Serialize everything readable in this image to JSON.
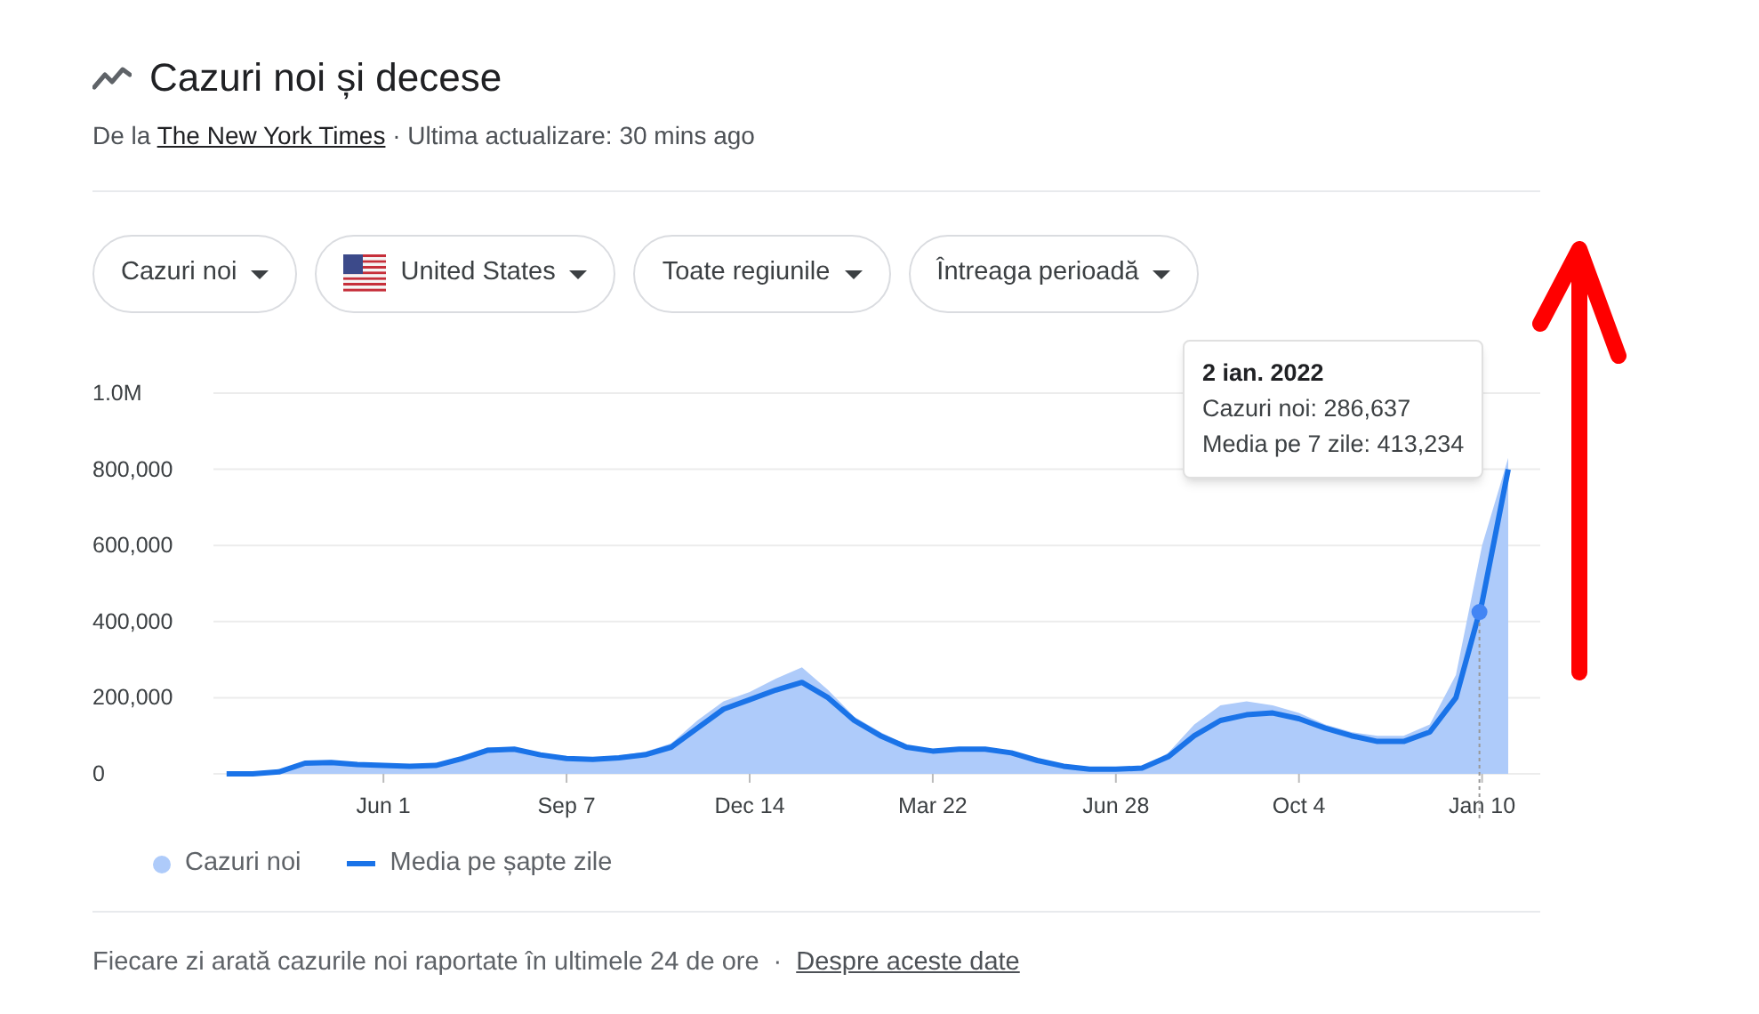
{
  "title": "Cazuri noi și decese",
  "source": {
    "prefix": "De la",
    "link": "The New York Times",
    "suffix": "· Ultima actualizare: 30 mins ago"
  },
  "filters": [
    {
      "label": "Cazuri noi",
      "kind": "plain"
    },
    {
      "label": "United States",
      "kind": "flag"
    },
    {
      "label": "Toate regiunile",
      "kind": "plain"
    },
    {
      "label": "Întreaga perioadă",
      "kind": "plain"
    }
  ],
  "chart": {
    "chart_data": {
      "type": "area",
      "grid": true,
      "categories": [
        null,
        null,
        null,
        null,
        null,
        null,
        "Jun 1",
        null,
        null,
        null,
        null,
        null,
        null,
        "Sep 7",
        null,
        null,
        null,
        null,
        null,
        null,
        "Dec 14",
        null,
        null,
        null,
        null,
        null,
        null,
        "Mar 22",
        null,
        null,
        null,
        null,
        null,
        null,
        "Jun 28",
        null,
        null,
        null,
        null,
        null,
        null,
        "Oct 4",
        null,
        null,
        null,
        null,
        null,
        null,
        "Jan 10",
        null
      ],
      "ylim": [
        0,
        1000000
      ],
      "yticks": [
        {
          "value": 0,
          "label": "0"
        },
        {
          "value": 200000,
          "label": "200,000"
        },
        {
          "value": 400000,
          "label": "400,000"
        },
        {
          "value": 600000,
          "label": "600,000"
        },
        {
          "value": 800000,
          "label": "800,000"
        },
        {
          "value": 1000000,
          "label": "1.0M"
        }
      ],
      "series": [
        {
          "name": "Cazuri noi",
          "type": "area",
          "color": "#aecbfa",
          "values": [
            0,
            0,
            6000,
            32000,
            33000,
            28000,
            25000,
            22000,
            25000,
            45000,
            70000,
            70000,
            55000,
            45000,
            42000,
            48000,
            58000,
            80000,
            140000,
            190000,
            215000,
            250000,
            280000,
            220000,
            150000,
            110000,
            75000,
            65000,
            70000,
            70000,
            60000,
            38000,
            22000,
            14000,
            14000,
            18000,
            55000,
            130000,
            180000,
            190000,
            180000,
            160000,
            130000,
            110000,
            100000,
            100000,
            130000,
            260000,
            600000,
            830000
          ]
        },
        {
          "name": "Media pe șapte zile",
          "type": "line",
          "color": "#1a73e8",
          "values": [
            0,
            0,
            5000,
            28000,
            30000,
            25000,
            22000,
            20000,
            22000,
            40000,
            62000,
            65000,
            50000,
            40000,
            38000,
            42000,
            50000,
            70000,
            120000,
            170000,
            195000,
            220000,
            240000,
            200000,
            140000,
            100000,
            70000,
            60000,
            65000,
            65000,
            55000,
            35000,
            20000,
            12000,
            12000,
            15000,
            45000,
            100000,
            140000,
            155000,
            160000,
            145000,
            120000,
            100000,
            85000,
            85000,
            110000,
            200000,
            450000,
            800000
          ]
        }
      ]
    },
    "tooltip": {
      "date": "2 ian. 2022",
      "lines": [
        "Cazuri noi: 286,637",
        "Media pe 7 zile: 413,234"
      ]
    }
  },
  "footer": {
    "note": "Fiecare zi arată cazurile noi raportate în ultimele 24 de ore",
    "separator": "·",
    "link": "Despre aceste date"
  }
}
